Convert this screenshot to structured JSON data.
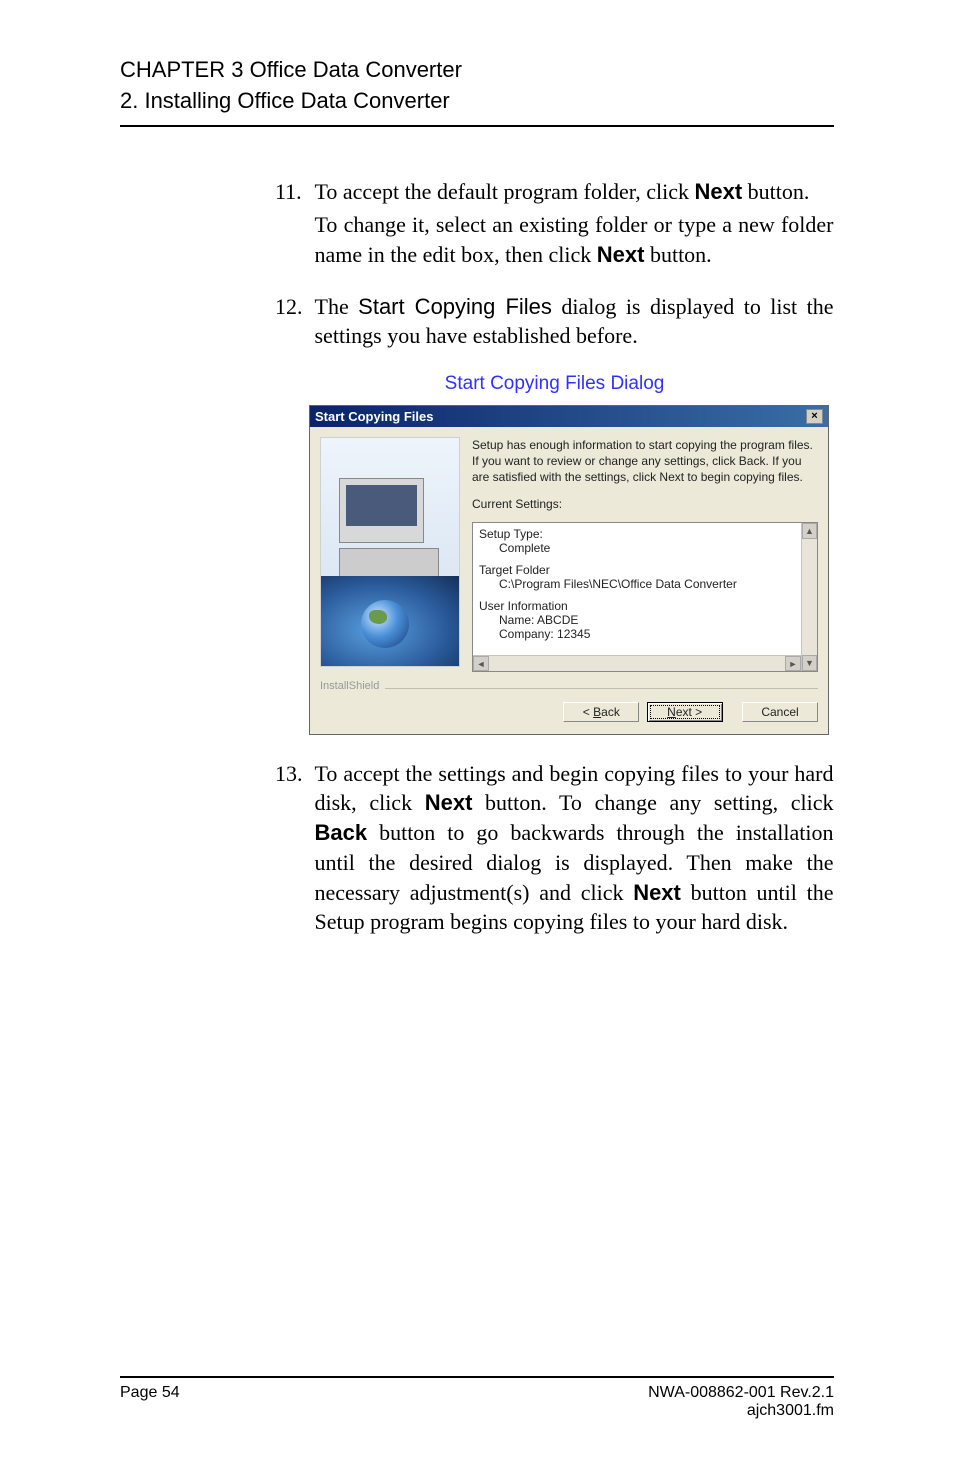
{
  "header": {
    "chapter": "CHAPTER 3 Office Data Converter",
    "section": "2. Installing Office Data Converter"
  },
  "items": {
    "n11": "11.",
    "t11a_pre": "To accept the default program folder, click ",
    "t11a_bold": "Next",
    "t11a_post": " button.",
    "t11b_pre": "To change it, select an existing folder or type a new folder name in the edit box, then click ",
    "t11b_bold": "Next",
    "t11b_post": " button.",
    "n12": "12.",
    "t12_pre": "The ",
    "t12_sans": "Start Copying Files",
    "t12_post": " dialog is displayed to list the settings you have established before.",
    "caption": "Start Copying Files Dialog",
    "n13": "13.",
    "t13_a": "To accept the settings and begin copying files to your hard disk, click ",
    "t13_b": "Next",
    "t13_c": " button. To change any setting, click ",
    "t13_d": "Back",
    "t13_e": " button to go backwards through the installation until the desired dialog is displayed. Then make the necessary adjustment(s) and click ",
    "t13_f": "Next",
    "t13_g": " button until the Setup program begins copying files to your hard disk."
  },
  "dialog": {
    "title": "Start Copying Files",
    "close": "×",
    "intro": "Setup has enough information to start copying the program files. If you want to review or change any settings, click Back.  If you are satisfied with the settings, click Next to begin copying files.",
    "current_label": "Current Settings:",
    "setup_type_label": "Setup Type:",
    "setup_type_value": "Complete",
    "target_label": "Target Folder",
    "target_value": "C:\\Program Files\\NEC\\Office Data Converter",
    "user_label": "User Information",
    "user_name": "Name: ABCDE",
    "user_company": "Company: 12345",
    "install_shield": "InstallShield",
    "back_u": "B",
    "back_rest": "ack",
    "next_u": "N",
    "next_rest": "ext >",
    "cancel": "Cancel"
  },
  "footer": {
    "page": "Page 54",
    "rev": "NWA-008862-001 Rev.2.1",
    "file": "ajch3001.fm"
  }
}
